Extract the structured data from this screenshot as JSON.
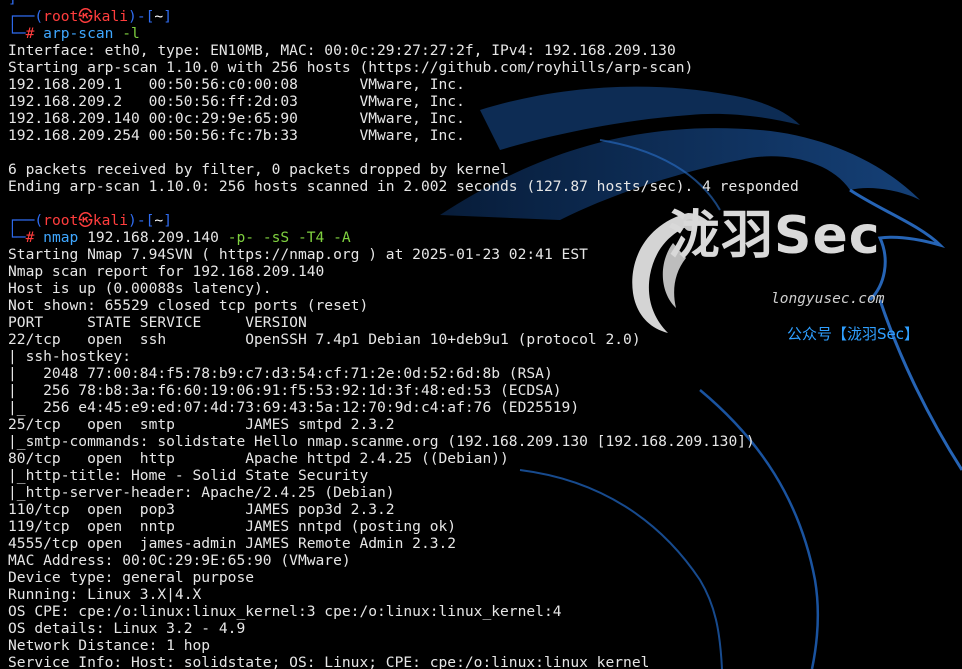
{
  "colors": {
    "background": "#000000",
    "prompt_frame": "#2f6cf0",
    "prompt_user": "#ff3d3d",
    "command": "#3fa7ff",
    "flags": "#7fd13f",
    "text": "#e6e6e6",
    "watermark_blue": "#2f9fff"
  },
  "prompt": {
    "top_open": "┌──(",
    "user": "root㉿kali",
    "mid": ")-[",
    "path": "~",
    "close": "]",
    "bottom": "└─",
    "hash": "# "
  },
  "commands": [
    {
      "cmd": "arp-scan",
      "target": "",
      "flags": " -l"
    },
    {
      "cmd": "nmap",
      "target": " 192.168.209.140",
      "flags": " -p- -sS -T4 -A"
    }
  ],
  "arp_output": [
    "Interface: eth0, type: EN10MB, MAC: 00:0c:29:27:27:2f, IPv4: 192.168.209.130",
    "Starting arp-scan 1.10.0 with 256 hosts (https://github.com/royhills/arp-scan)",
    "192.168.209.1   00:50:56:c0:00:08       VMware, Inc.",
    "192.168.209.2   00:50:56:ff:2d:03       VMware, Inc.",
    "192.168.209.140 00:0c:29:9e:65:90       VMware, Inc.",
    "192.168.209.254 00:50:56:fc:7b:33       VMware, Inc.",
    "",
    "6 packets received by filter, 0 packets dropped by kernel",
    "Ending arp-scan 1.10.0: 256 hosts scanned in 2.002 seconds (127.87 hosts/sec). 4 responded"
  ],
  "nmap_output": [
    "Starting Nmap 7.94SVN ( https://nmap.org ) at 2025-01-23 02:41 EST",
    "Nmap scan report for 192.168.209.140",
    "Host is up (0.00088s latency).",
    "Not shown: 65529 closed tcp ports (reset)",
    "PORT     STATE SERVICE     VERSION",
    "22/tcp   open  ssh         OpenSSH 7.4p1 Debian 10+deb9u1 (protocol 2.0)",
    "| ssh-hostkey:",
    "|   2048 77:00:84:f5:78:b9:c7:d3:54:cf:71:2e:0d:52:6d:8b (RSA)",
    "|   256 78:b8:3a:f6:60:19:06:91:f5:53:92:1d:3f:48:ed:53 (ECDSA)",
    "|_  256 e4:45:e9:ed:07:4d:73:69:43:5a:12:70:9d:c4:af:76 (ED25519)",
    "25/tcp   open  smtp        JAMES smtpd 2.3.2",
    "|_smtp-commands: solidstate Hello nmap.scanme.org (192.168.209.130 [192.168.209.130])",
    "80/tcp   open  http        Apache httpd 2.4.25 ((Debian))",
    "|_http-title: Home - Solid State Security",
    "|_http-server-header: Apache/2.4.25 (Debian)",
    "110/tcp  open  pop3        JAMES pop3d 2.3.2",
    "119/tcp  open  nntp        JAMES nntpd (posting ok)",
    "4555/tcp open  james-admin JAMES Remote Admin 2.3.2",
    "MAC Address: 00:0C:29:9E:65:90 (VMware)",
    "Device type: general purpose",
    "Running: Linux 3.X|4.X",
    "OS CPE: cpe:/o:linux:linux_kernel:3 cpe:/o:linux:linux_kernel:4",
    "OS details: Linux 3.2 - 4.9",
    "Network Distance: 1 hop",
    "Service Info: Host: solidstate; OS: Linux; CPE: cpe:/o:linux:linux_kernel"
  ],
  "watermark": {
    "brand_cjk": "泷羽",
    "brand_sec": "Sec",
    "url": "longyusec.com",
    "public_account": "公众号【泷羽Sec】"
  },
  "icons": {
    "background": "kali-dragon-icon",
    "logo": "longyusec-swirl-icon"
  }
}
